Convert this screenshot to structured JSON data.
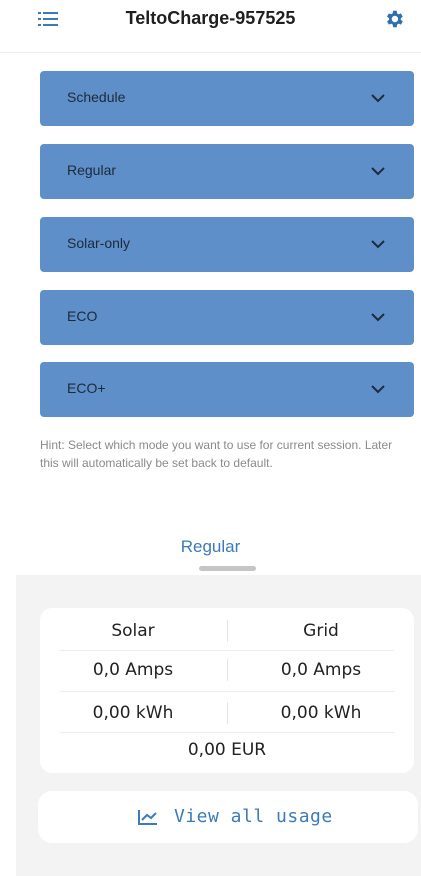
{
  "header": {
    "title": "TeltoCharge-957525",
    "menu_icon": "hamburger-menu-icon",
    "settings_icon": "gear-icon"
  },
  "modes": [
    {
      "label": "Schedule"
    },
    {
      "label": "Regular"
    },
    {
      "label": "Solar-only"
    },
    {
      "label": "ECO"
    },
    {
      "label": "ECO+"
    }
  ],
  "hint": "Hint: Select which mode you want to use for current session. Later this will automatically be set back to default.",
  "active_mode": "Regular",
  "stats": {
    "headers": [
      "Solar",
      "Grid"
    ],
    "current": [
      "0,0 Amps",
      "0,0 Amps"
    ],
    "energy": [
      "0,00 kWh",
      "0,00 kWh"
    ],
    "cost": "0,00 EUR"
  },
  "usage_button": {
    "label": "View all usage",
    "icon": "line-chart-icon"
  },
  "colors": {
    "accent": "#3d7bb6",
    "accordion": "#5f8fc9",
    "sheet_bg": "#f3f3f4"
  }
}
